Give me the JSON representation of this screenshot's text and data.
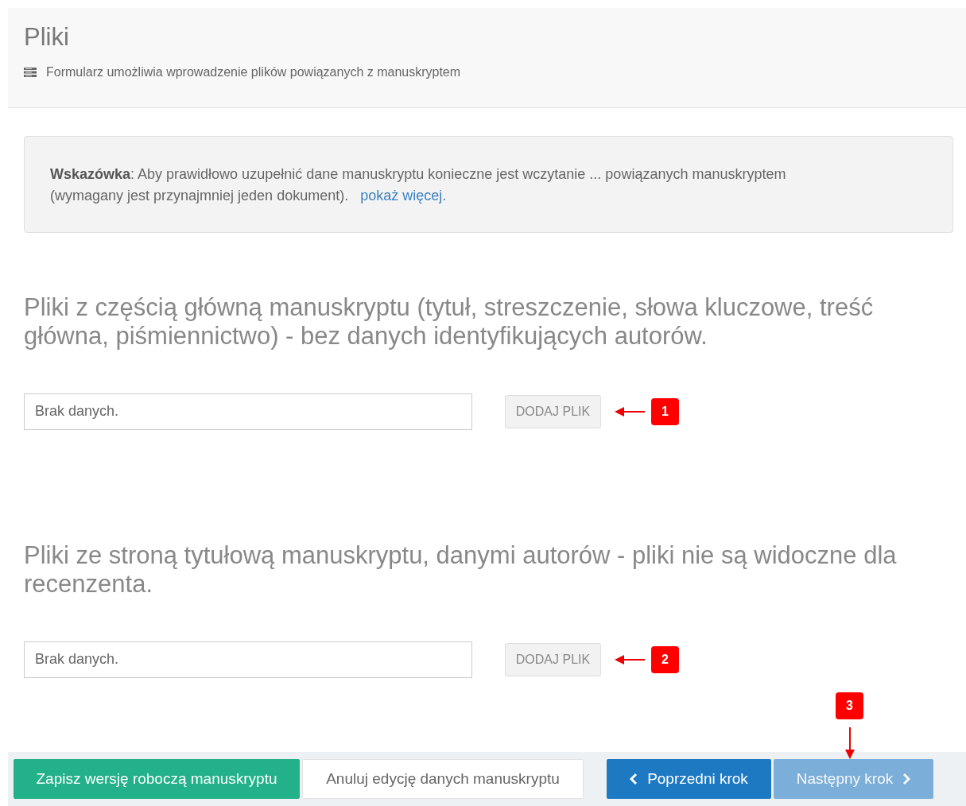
{
  "header": {
    "title": "Pliki",
    "subtitle": "Formularz umożliwia wprowadzenie plików powiązanych z manuskryptem"
  },
  "hint": {
    "text": "**Wskazówka**: Aby prawidłowo uzupełnić dane manuskryptu konieczne jest wczytanie ... powiązanych manuskryptem (wymagany jest przynajmniej jeden dokument).",
    "link": "pokaż więcej."
  },
  "sections": [
    {
      "heading": "Pliki z częścią główną manuskryptu (tytuł, streszczenie, słowa kluczowe, treść główna, piśmiennictwo) - bez danych identyfikujących autorów.",
      "field_value": "Brak danych.",
      "button": "DODAJ PLIK",
      "callout": "1"
    },
    {
      "heading": "Pliki ze stroną tytułową manuskryptu, danymi autorów - pliki nie są widoczne dla recenzenta.",
      "field_value": "Brak danych.",
      "button": "DODAJ PLIK",
      "callout": "2"
    }
  ],
  "footer": {
    "buttons": [
      {
        "label": "Zapisz wersję roboczą manuskryptu",
        "kind": "save",
        "disabled": false
      },
      {
        "label": "Anuluj edycję danych manuskryptu",
        "kind": "cancel",
        "disabled": false
      },
      {
        "label": "Poprzedni krok",
        "kind": "prev",
        "disabled": false
      },
      {
        "label": "Następny krok",
        "kind": "next",
        "disabled": true,
        "callout": "3"
      }
    ]
  }
}
